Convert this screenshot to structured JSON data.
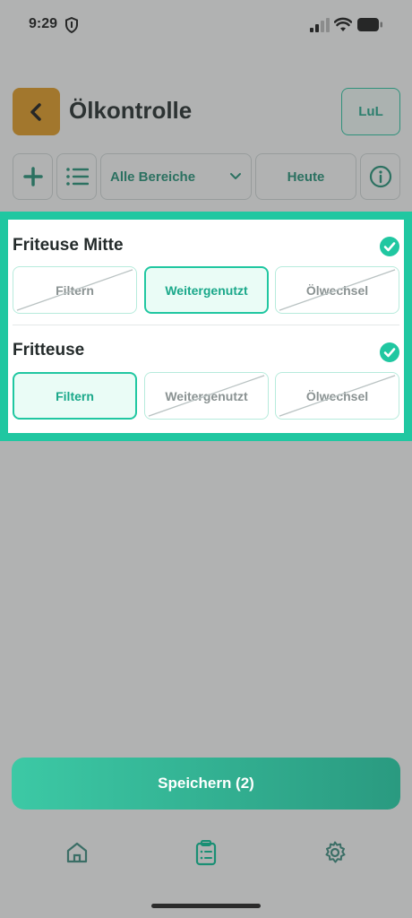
{
  "status_bar": {
    "time": "9:29"
  },
  "header": {
    "title": "Ölkontrolle",
    "user_badge": "LuL"
  },
  "toolbar": {
    "area_select": "Alle Bereiche",
    "date_filter": "Heute"
  },
  "groups": [
    {
      "title": "Friteuse Mitte",
      "checked": true,
      "options": [
        {
          "label": "Filtern",
          "selected": false,
          "struck": true
        },
        {
          "label": "Weitergenutzt",
          "selected": true,
          "struck": false
        },
        {
          "label": "Ölwechsel",
          "selected": false,
          "struck": true
        }
      ]
    },
    {
      "title": "Fritteuse",
      "checked": true,
      "options": [
        {
          "label": "Filtern",
          "selected": true,
          "struck": false
        },
        {
          "label": "Weitergenutzt",
          "selected": false,
          "struck": true
        },
        {
          "label": "Ölwechsel",
          "selected": false,
          "struck": true
        }
      ]
    }
  ],
  "save_button": "Speichern (2)",
  "colors": {
    "accent": "#20c7a1",
    "back_button": "#e59a1b",
    "save_gradient_start": "#3cc9a5",
    "save_gradient_end": "#2a9a80"
  },
  "bottom_nav": [
    "home-icon",
    "clipboard-list-icon",
    "gear-icon"
  ]
}
